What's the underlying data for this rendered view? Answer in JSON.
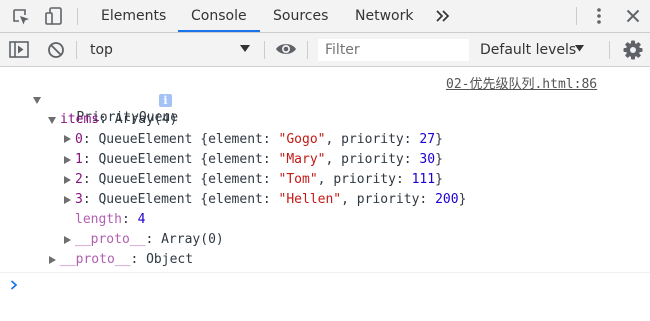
{
  "tabs": {
    "items": [
      "Elements",
      "Console",
      "Sources",
      "Network"
    ],
    "overflow_icon": "double-chevron-right-icon",
    "active": "Console"
  },
  "toolbar": {
    "context": "top",
    "filter_placeholder": "Filter",
    "levels": "Default levels"
  },
  "console": {
    "source_link": "02-优先级队列.html:86",
    "root_label": "PriorityQueue",
    "info_badge": "i",
    "items_key": "items",
    "items_value": "Array(4)",
    "elements": [
      {
        "index": "0",
        "class": "QueueElement",
        "element": "\"Gogo\"",
        "priority": "27"
      },
      {
        "index": "1",
        "class": "QueueElement",
        "element": "\"Mary\"",
        "priority": "30"
      },
      {
        "index": "2",
        "class": "QueueElement",
        "element": "\"Tom\"",
        "priority": "111"
      },
      {
        "index": "3",
        "class": "QueueElement",
        "element": "\"Hellen\"",
        "priority": "200"
      }
    ],
    "element_key": "element",
    "priority_key": "priority",
    "length_key": "length",
    "length_value": "4",
    "proto_key": "__proto__",
    "array_proto_value": "Array(0)",
    "object_proto_value": "Object"
  },
  "colors": {
    "accent": "#1a73e8",
    "key_purple": "#881280",
    "string_red": "#c41a16",
    "number_blue": "#1c00cf",
    "prompt_blue": "#1a73e8"
  }
}
